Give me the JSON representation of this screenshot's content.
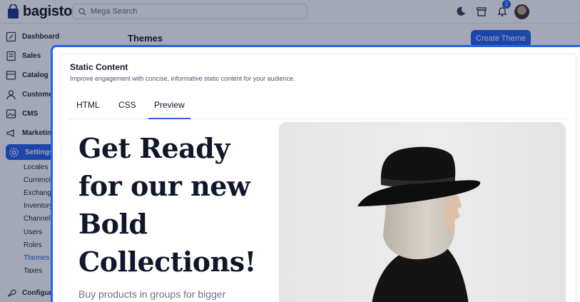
{
  "app": {
    "brand": "bagisto",
    "search_placeholder": "Mega Search",
    "notification_count": "2"
  },
  "sidebar": {
    "items": [
      {
        "label": "Dashboard",
        "icon": "dashboard-icon"
      },
      {
        "label": "Sales",
        "icon": "sales-icon"
      },
      {
        "label": "Catalog",
        "icon": "catalog-icon"
      },
      {
        "label": "Custome",
        "icon": "customers-icon"
      },
      {
        "label": "CMS",
        "icon": "cms-icon"
      },
      {
        "label": "Marketin",
        "icon": "marketing-icon"
      },
      {
        "label": "Settings",
        "icon": "settings-icon"
      }
    ],
    "settings_sub": [
      "Locales",
      "Currencie",
      "Exchange",
      "Inventory",
      "Channels",
      "Users",
      "Roles",
      "Themes",
      "Taxes"
    ],
    "bottom_item": {
      "label": "Configur",
      "icon": "wrench-icon"
    }
  },
  "page": {
    "title": "Themes",
    "create_button": "Create Theme"
  },
  "panel": {
    "title": "Static Content",
    "subtitle": "Improve engagement with concise, informative static content for your audience.",
    "tabs": [
      "HTML",
      "CSS",
      "Preview"
    ],
    "active_tab": "Preview"
  },
  "preview": {
    "heading_lines": [
      "Get Ready",
      "for our new",
      "Bold",
      "Collections!"
    ],
    "body_text": "Buy products in groups for bigger discounts. Like lorem ipsum is"
  },
  "colors": {
    "accent": "#2563eb",
    "heading": "#0f172a"
  }
}
